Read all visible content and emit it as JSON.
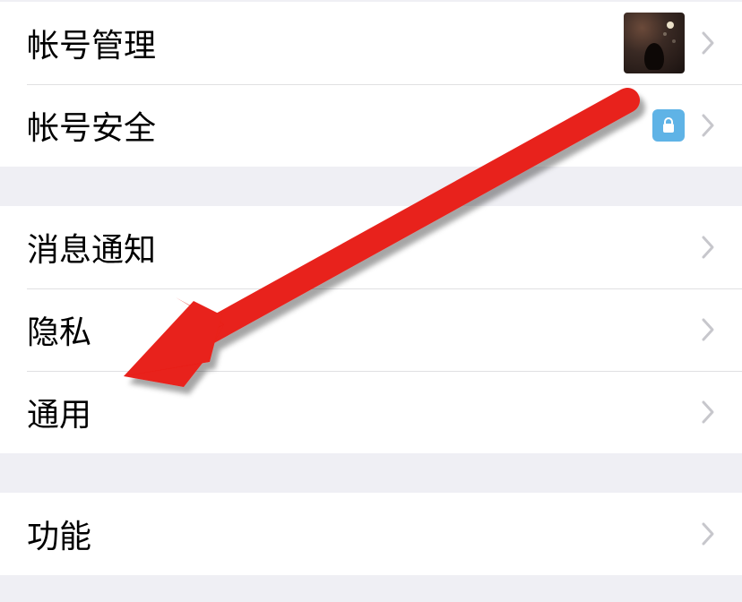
{
  "groups": [
    {
      "rows": [
        {
          "id": "account-management",
          "label": "帐号管理",
          "trailing": "avatar"
        },
        {
          "id": "account-security",
          "label": "帐号安全",
          "trailing": "lock"
        }
      ]
    },
    {
      "rows": [
        {
          "id": "notifications",
          "label": "消息通知",
          "trailing": null
        },
        {
          "id": "privacy",
          "label": "隐私",
          "trailing": null
        },
        {
          "id": "general",
          "label": "通用",
          "trailing": null
        }
      ]
    },
    {
      "rows": [
        {
          "id": "features",
          "label": "功能",
          "trailing": null
        }
      ]
    }
  ],
  "annotation": {
    "type": "arrow",
    "color": "#e8201a",
    "target": "general"
  }
}
